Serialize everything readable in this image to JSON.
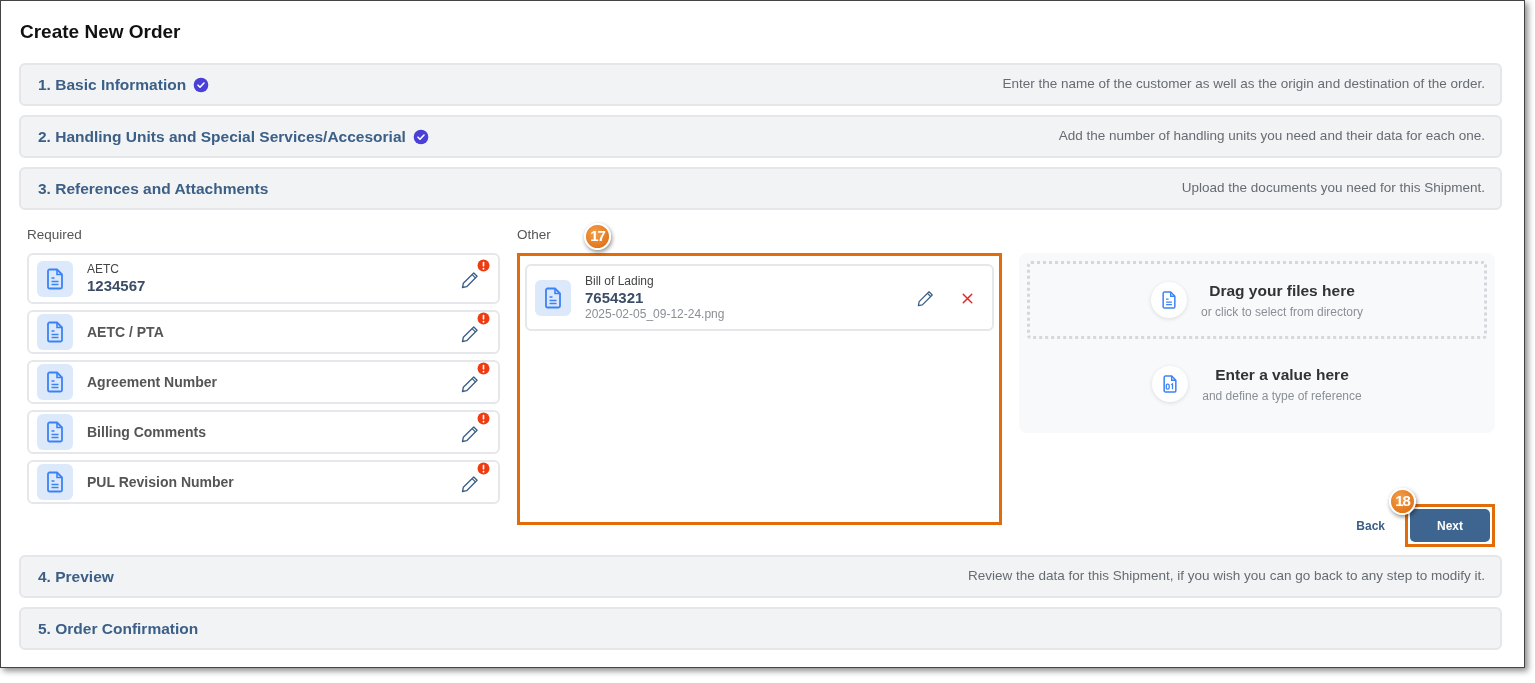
{
  "title": "Create New Order",
  "steps": [
    {
      "title": "1. Basic Information",
      "completed": true,
      "expanded": false,
      "description": "Enter the name of the customer as well as the origin and destination of the order."
    },
    {
      "title": "2. Handling Units and Special Services/Accesorial",
      "completed": true,
      "expanded": false,
      "description": "Add the number of handling units you need and their data for each one."
    },
    {
      "title": "3. References and Attachments",
      "completed": false,
      "expanded": true,
      "description": "Upload the documents you need for this Shipment."
    },
    {
      "title": "4. Preview",
      "completed": false,
      "expanded": false,
      "description": "Review the data for this Shipment, if you wish you can go back to any step to modify it."
    },
    {
      "title": "5. Order Confirmation",
      "completed": false,
      "expanded": false
    }
  ],
  "required": {
    "heading": "Required",
    "items": [
      {
        "label": "AETC",
        "value": "1234567",
        "warning": true
      },
      {
        "label": "AETC / PTA",
        "warning": true
      },
      {
        "label": "Agreement Number",
        "warning": true
      },
      {
        "label": "Billing Comments",
        "warning": true
      },
      {
        "label": "PUL Revision Number",
        "warning": true
      }
    ]
  },
  "other": {
    "heading": "Other",
    "callout": "17",
    "items": [
      {
        "label": "Bill of Lading",
        "value": "7654321",
        "file": "2025-02-05_09-12-24.png"
      }
    ]
  },
  "upload_options": [
    {
      "kind": "dropzone",
      "title": "Drag your files here",
      "subtitle": "or click to select from directory"
    },
    {
      "kind": "value",
      "title": "Enter a value here",
      "subtitle": "and define a type of reference"
    }
  ],
  "back_label": "Back",
  "next": {
    "label": "Next",
    "callout": "18"
  }
}
